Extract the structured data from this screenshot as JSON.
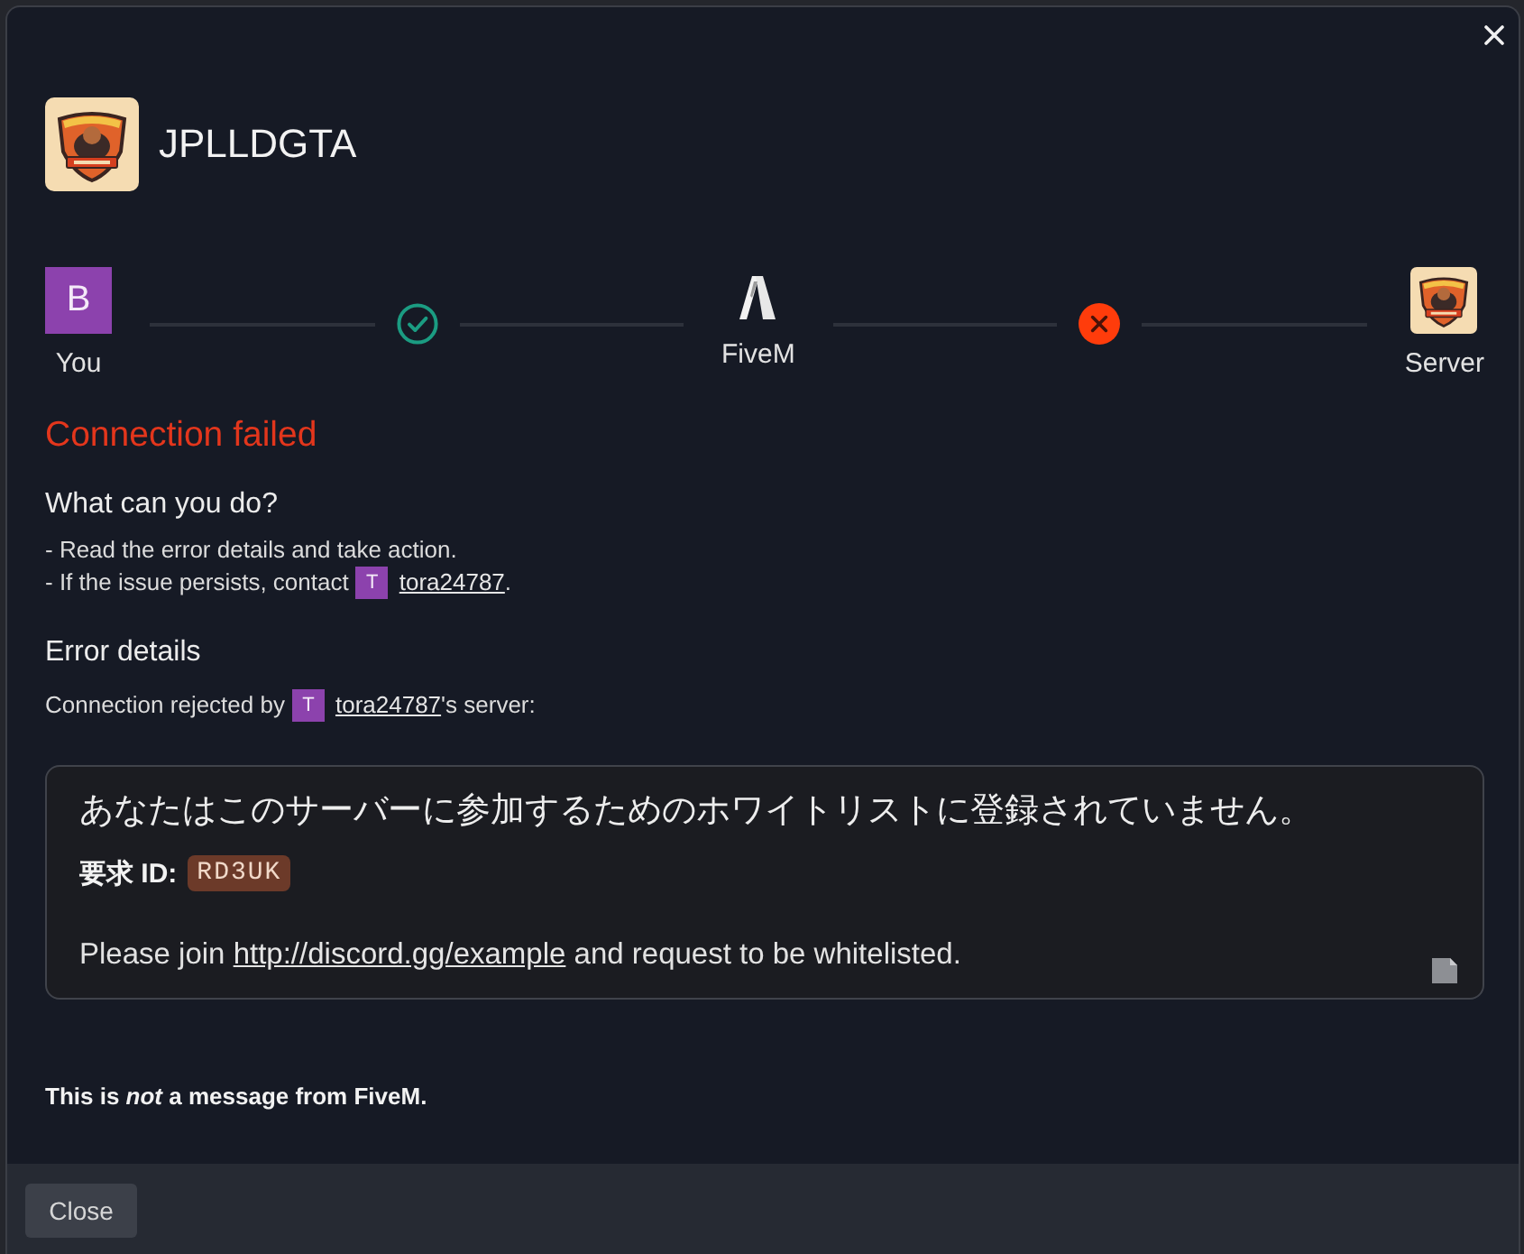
{
  "dialog": {
    "title": "JPLLDGTA"
  },
  "steps": [
    {
      "kind": "avatar",
      "initial": "B",
      "label": "You"
    },
    {
      "kind": "status",
      "ok": true
    },
    {
      "kind": "logo",
      "label": "FiveM"
    },
    {
      "kind": "status",
      "ok": false
    },
    {
      "kind": "server",
      "label": "Server"
    }
  ],
  "error_title": "Connection failed",
  "help": {
    "heading": "What can you do?",
    "items": [
      {
        "text": "- Read the error details and take action."
      },
      {
        "text": "- If the issue persists, contact",
        "user": {
          "initial": "T",
          "name": "tora24787"
        },
        "suffix": "."
      }
    ]
  },
  "details": {
    "heading": "Error details",
    "intro": {
      "text": "Connection rejected by",
      "user": {
        "initial": "T",
        "name": "tora24787"
      },
      "suffix": "'s server:"
    },
    "message": {
      "text": "あなたはこのサーバーに参加するためのホワイトリストに登録されていません。",
      "id_label": "要求 ID:",
      "id_value": "RD3UK",
      "join_text": "Please join",
      "link": "http://discord.gg/example",
      "join_suffix": "and request to be whitelisted."
    }
  },
  "disclaimer": "This is *not* a message from FiveM.",
  "footer": {
    "button": "Close"
  }
}
